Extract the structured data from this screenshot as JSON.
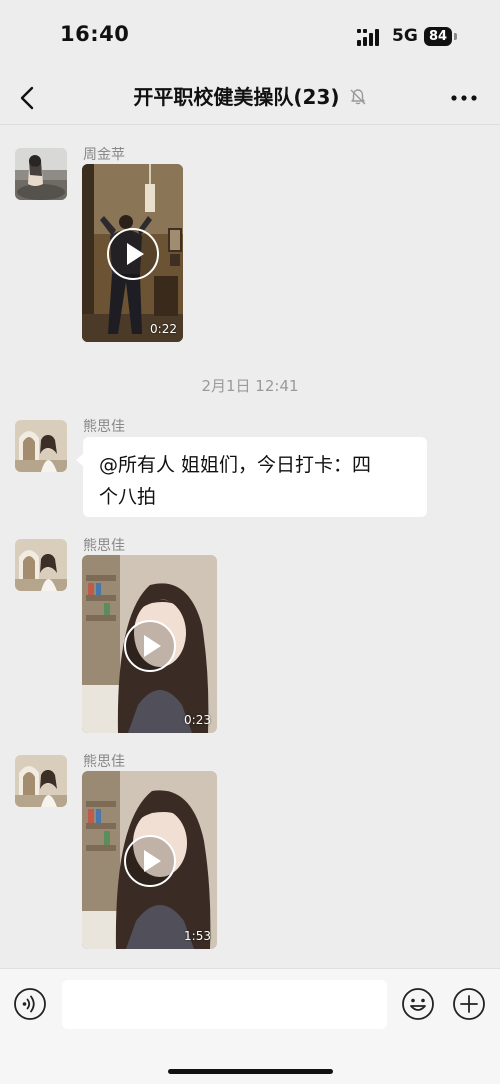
{
  "status_bar": {
    "time": "16:40",
    "network": "5G",
    "battery": "84",
    "signal_icon": "signal-bars-icon"
  },
  "header": {
    "title": "开平职校健美操队(23)",
    "back_icon": "chevron-left-icon",
    "mute_icon": "bell-muted-icon",
    "more_icon": "more-dots-icon"
  },
  "messages": [
    {
      "type": "video",
      "sender": "周金苹",
      "duration": "0:22"
    },
    {
      "type": "timestamp",
      "text": "2月1日 12:41"
    },
    {
      "type": "text",
      "sender": "熊思佳",
      "text_line1": "@所有人 姐姐们，今日打卡：四",
      "text_line2": "个八拍"
    },
    {
      "type": "video",
      "sender": "熊思佳",
      "duration": "0:23"
    },
    {
      "type": "video",
      "sender": "熊思佳",
      "duration": "1:53"
    }
  ],
  "input_bar": {
    "input_value": "",
    "voice_icon": "voice-icon",
    "emoji_icon": "emoji-icon",
    "add_icon": "plus-icon"
  },
  "colors": {
    "background": "#ededed",
    "bubble": "#ffffff",
    "meta_text": "#888888"
  }
}
